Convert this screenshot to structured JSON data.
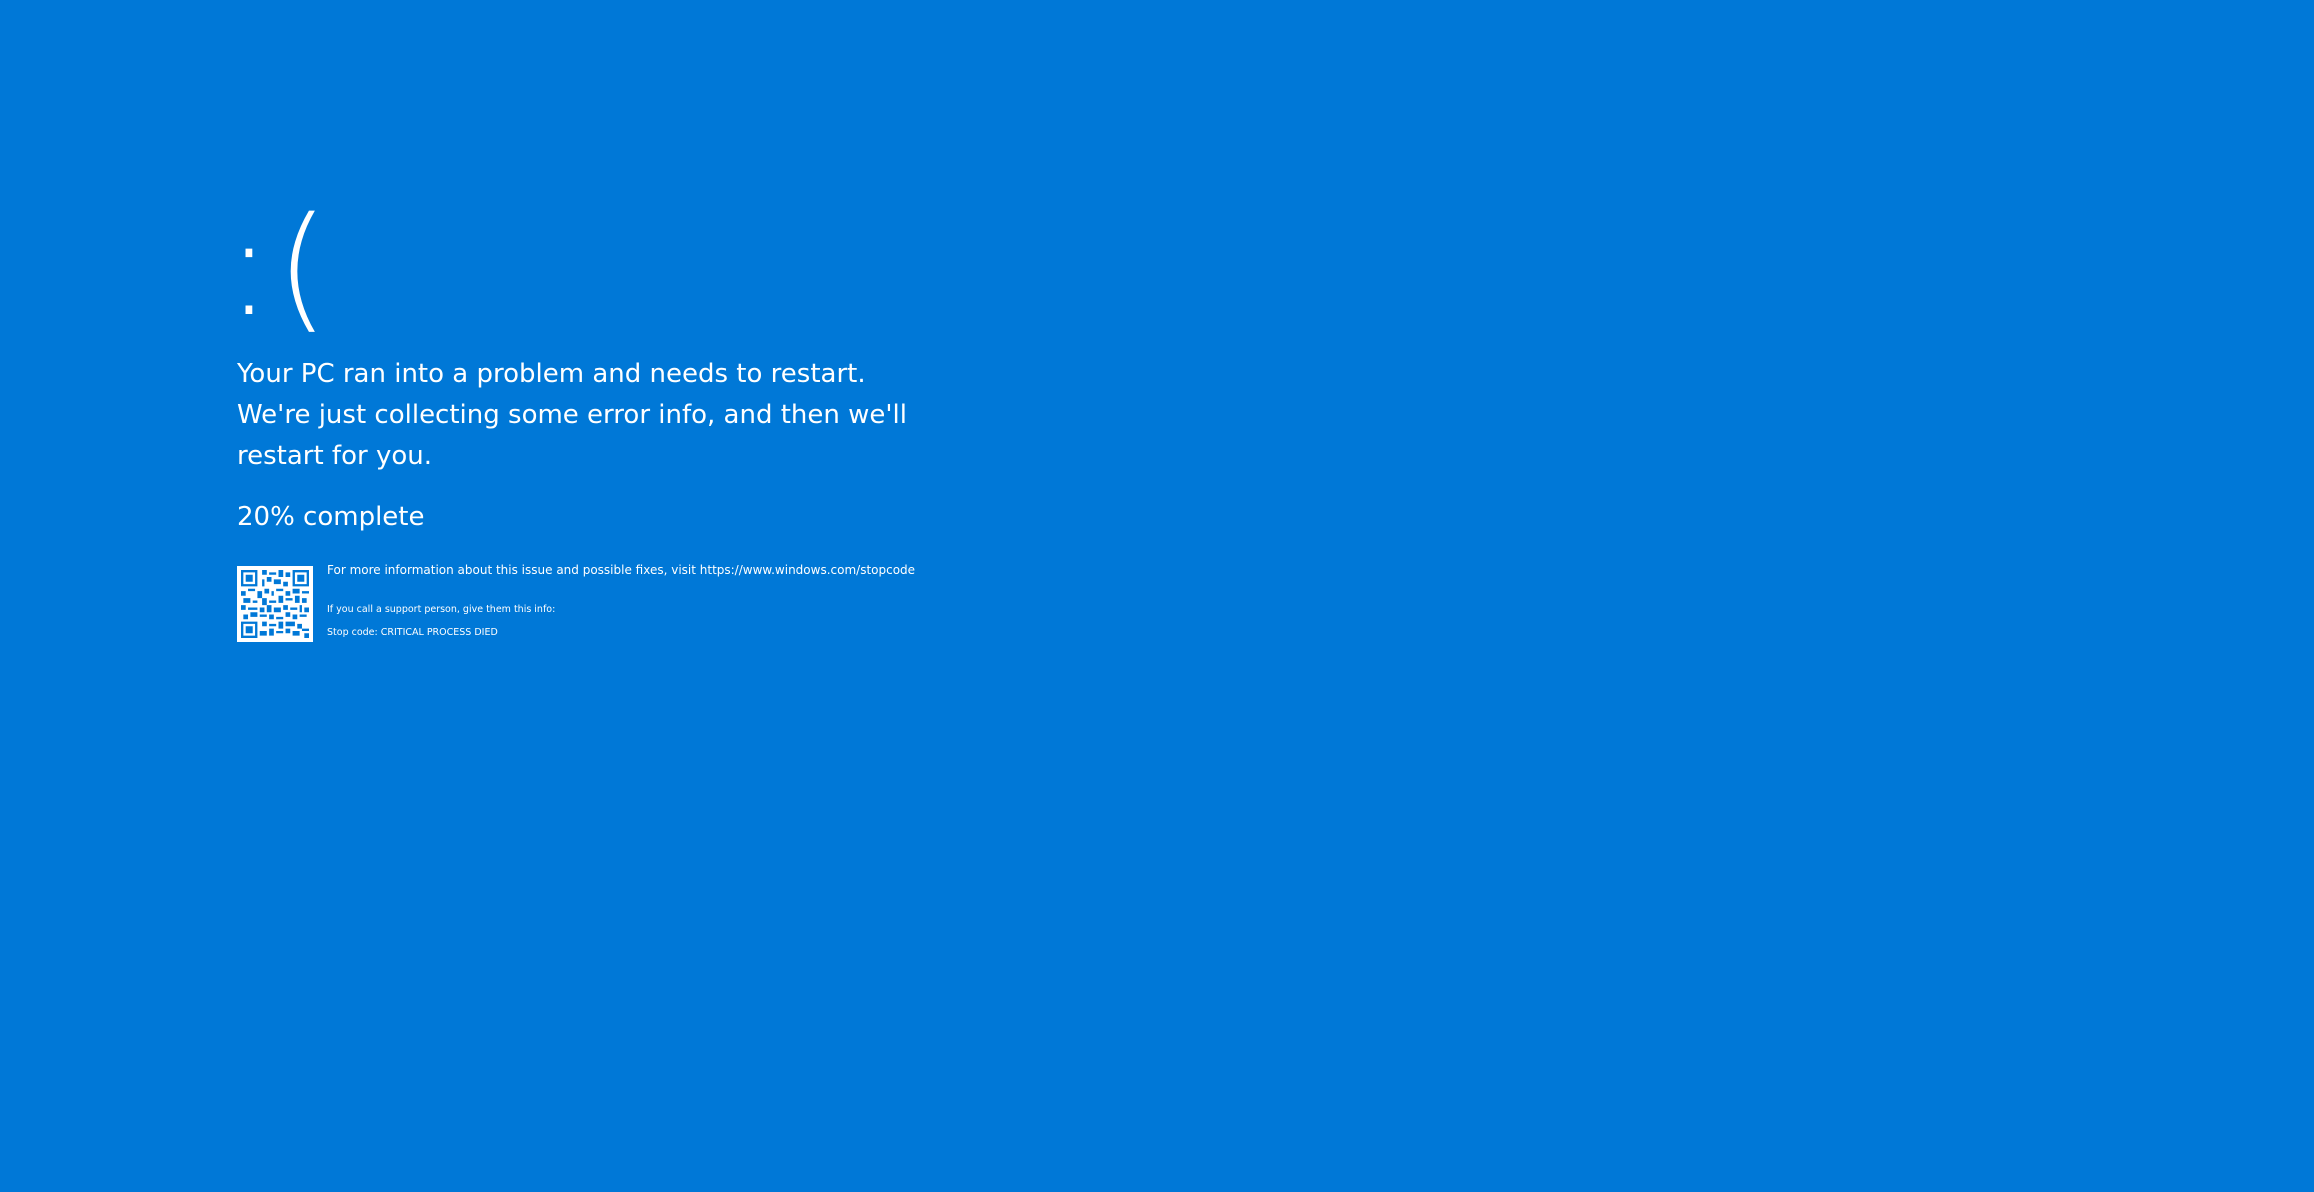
{
  "screen": {
    "background_color": "#0078d7",
    "text_color": "#ffffff",
    "emoticon": ":(",
    "message": "Your PC ran into a problem and needs to restart. We're just collecting some error info, and then we'll restart for you.",
    "progress_percent": 20,
    "progress_text": "20% complete",
    "info_text": "For more information about this issue and possible fixes, visit https://www.windows.com/stopcode",
    "support_text": "If you call a support person, give them this info:",
    "stop_code_text": "Stop code: CRITICAL PROCESS DIED",
    "qr_icon": "qr-code-icon"
  }
}
